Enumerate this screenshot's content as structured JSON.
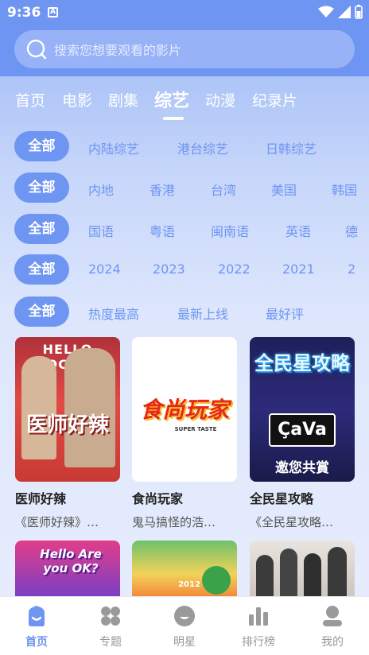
{
  "status": {
    "time": "9:36",
    "notif": "A"
  },
  "search": {
    "placeholder": "搜索您想要观看的影片"
  },
  "tabs": [
    "首页",
    "电影",
    "剧集",
    "综艺",
    "动漫",
    "纪录片"
  ],
  "active_tab": "综艺",
  "filters": [
    {
      "all": "全部",
      "options": [
        "内陆综艺",
        "港台综艺",
        "日韩综艺"
      ]
    },
    {
      "all": "全部",
      "options": [
        "内地",
        "香港",
        "台湾",
        "美国",
        "韩国"
      ]
    },
    {
      "all": "全部",
      "options": [
        "国语",
        "粤语",
        "闽南语",
        "英语",
        "德"
      ]
    },
    {
      "all": "全部",
      "options": [
        "2024",
        "2023",
        "2022",
        "2021",
        "2"
      ]
    },
    {
      "all": "全部",
      "options": [
        "热度最高",
        "最新上线",
        "最好评"
      ]
    }
  ],
  "cards": [
    {
      "title": "医师好辣",
      "subtitle": "《医师好辣》…",
      "poster_text": "医师好辣",
      "poster_top": "HELLO DOCTOR"
    },
    {
      "title": "食尚玩家",
      "subtitle": "鬼马搞怪的浩…",
      "poster_text": "食尚玩家",
      "poster_sub": "SUPER TASTE"
    },
    {
      "title": "全民星攻略",
      "subtitle": "《全民星攻略…",
      "poster_text": "全民星攻略",
      "poster_brand": "ÇaVa",
      "poster_brand_sub": "邀您共賞"
    }
  ],
  "cards_row2": [
    {
      "poster_text": "Hello Are you OK?"
    },
    {
      "poster_text": "2012"
    },
    {
      "poster_text": ""
    }
  ],
  "nav": [
    {
      "label": "首页",
      "icon": "home-icon",
      "active": true
    },
    {
      "label": "专题",
      "icon": "topics-icon",
      "active": false
    },
    {
      "label": "明星",
      "icon": "star-icon",
      "active": false
    },
    {
      "label": "排行榜",
      "icon": "ranking-icon",
      "active": false
    },
    {
      "label": "我的",
      "icon": "profile-icon",
      "active": false
    }
  ],
  "colors": {
    "accent": "#6f95f3",
    "header": "#6f95f3"
  }
}
